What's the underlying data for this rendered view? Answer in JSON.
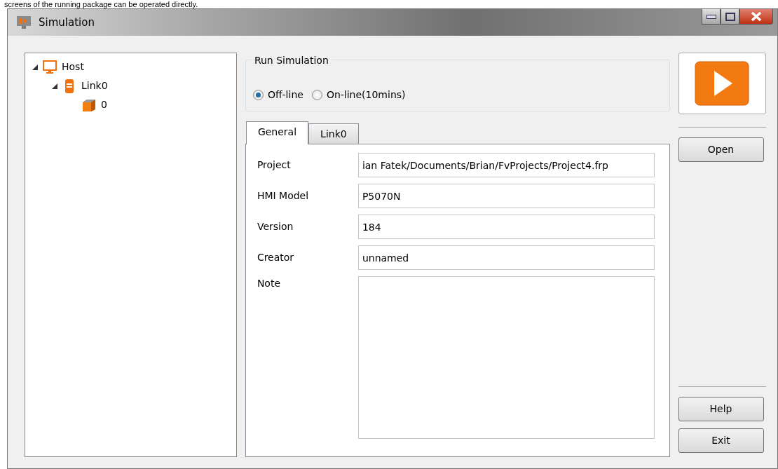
{
  "caption": "screens of the running package can be operated directly.",
  "window": {
    "title": "Simulation"
  },
  "tree": [
    {
      "label": "Host",
      "kind": "host",
      "expanded": true,
      "children": [
        {
          "label": "Link0",
          "kind": "link",
          "expanded": true,
          "children": [
            {
              "label": "0",
              "kind": "device"
            }
          ]
        }
      ]
    }
  ],
  "run_simulation": {
    "title": "Run Simulation",
    "options": [
      {
        "label": "Off-line",
        "selected": true
      },
      {
        "label": "On-line(10mins)",
        "selected": false
      }
    ]
  },
  "tabs": [
    {
      "label": "General",
      "selected": true
    },
    {
      "label": "Link0",
      "selected": false
    }
  ],
  "fields": [
    {
      "label": "Project",
      "value": "ian Fatek/Documents/Brian/FvProjects/Project4.frp",
      "kind": "line"
    },
    {
      "label": "HMI Model",
      "value": "P5070N",
      "kind": "line"
    },
    {
      "label": "Version",
      "value": "184",
      "kind": "line"
    },
    {
      "label": "Creator",
      "value": "unnamed",
      "kind": "line"
    },
    {
      "label": "Note",
      "kind": "area"
    }
  ],
  "buttons": {
    "open": "Open",
    "help": "Help",
    "exit": "Exit"
  }
}
